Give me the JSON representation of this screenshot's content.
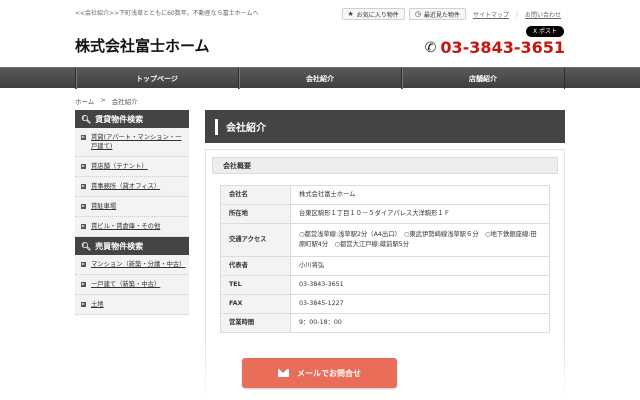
{
  "header": {
    "tagline": "<<会社紹介>>下町浅草とともに60数年。不動産なら富士ホームへ",
    "favorites_label": "お気に入り物件",
    "recent_label": "最近見た物件",
    "sitemap_label": "サイトマップ",
    "contact_label": "お問い合わせ",
    "logo": "株式会社富士ホーム",
    "x_post_label": "X ポスト",
    "phone": "03-3843-3651"
  },
  "nav": {
    "items": [
      "トップページ",
      "会社紹介",
      "店舗紹介"
    ]
  },
  "breadcrumb": {
    "home": "ホーム",
    "sep": ">",
    "current": "会社紹介"
  },
  "sidebar": {
    "rent_title": "賃貸物件検索",
    "rent_items": [
      "賃貸(アパート・マンション・一戸建て)",
      "賃店舗（テナント）",
      "賃事務所（貸オフィス）",
      "賃駐車場",
      "賃ビル・賃倉庫・その他"
    ],
    "sale_title": "売買物件検索",
    "sale_items": [
      "マンション（新築・分譲・中古）",
      "一戸建て（新築・中古）",
      "土地"
    ]
  },
  "main": {
    "title": "会社紹介",
    "subhead": "会社概要",
    "rows": [
      {
        "key": "会社名",
        "value": "株式会社富士ホーム"
      },
      {
        "key": "所在地",
        "value": "台東区駒形１丁目１０－５ダイアパレス大洋駒形１Ｆ"
      },
      {
        "key": "交通アクセス",
        "value": "○都営浅草線:浅草駅2分（A4出口）　○東武伊勢崎線浅草駅６分　○地下鉄銀座線:田原町駅4分　○都営大江戸線:蔵前駅5分"
      },
      {
        "key": "代表者",
        "value": "小川将弘"
      },
      {
        "key": "TEL",
        "value": "03-3843-3651"
      },
      {
        "key": "FAX",
        "value": "03-3845-1227"
      },
      {
        "key": "営業時間",
        "value": "9：00-18：00"
      }
    ]
  },
  "cta": {
    "mail_label": "メールでお問合せ"
  }
}
